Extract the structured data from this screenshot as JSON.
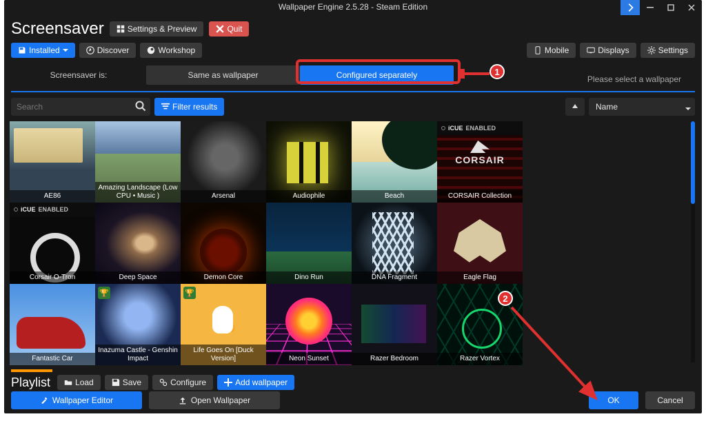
{
  "window": {
    "title": "Wallpaper Engine 2.5.28 - Steam Edition"
  },
  "header": {
    "page_title": "Screensaver",
    "settings_preview": "Settings & Preview",
    "quit": "Quit"
  },
  "nav": {
    "installed": "Installed",
    "discover": "Discover",
    "workshop": "Workshop",
    "mobile": "Mobile",
    "displays": "Displays",
    "settings": "Settings"
  },
  "mode": {
    "label": "Screensaver is:",
    "same": "Same as wallpaper",
    "separate": "Configured separately"
  },
  "filter": {
    "search_placeholder": "Search",
    "filter_results": "Filter results",
    "sort_field": "Name"
  },
  "right_pane": {
    "empty": "Please select a wallpaper"
  },
  "tiles": [
    {
      "label": "AE86",
      "bg": "bg-ae86",
      "trophy": false,
      "icue": false
    },
    {
      "label": "Amazing Landscape (Low CPU • Music )",
      "bg": "bg-landscape",
      "trophy": false,
      "icue": false
    },
    {
      "label": "Arsenal",
      "bg": "bg-arsenal",
      "trophy": false,
      "icue": false
    },
    {
      "label": "Audiophile",
      "bg": "bg-audio",
      "trophy": false,
      "icue": false
    },
    {
      "label": "Beach",
      "bg": "bg-beach",
      "trophy": false,
      "icue": false
    },
    {
      "label": "CORSAIR Collection",
      "bg": "bg-corsair",
      "trophy": false,
      "icue": true,
      "corsair_label": "CORSAIR"
    },
    {
      "label": "Corsair O-Tron",
      "bg": "bg-otron",
      "trophy": false,
      "icue": true
    },
    {
      "label": "Deep Space",
      "bg": "bg-deepspace",
      "trophy": false,
      "icue": false
    },
    {
      "label": "Demon Core",
      "bg": "bg-demon",
      "trophy": false,
      "icue": false
    },
    {
      "label": "Dino Run",
      "bg": "bg-dino",
      "trophy": false,
      "icue": false
    },
    {
      "label": "DNA Fragment",
      "bg": "bg-dna",
      "trophy": false,
      "icue": false
    },
    {
      "label": "Eagle Flag",
      "bg": "bg-eagle",
      "trophy": false,
      "icue": false
    },
    {
      "label": "Fantastic Car",
      "bg": "bg-car",
      "trophy": false,
      "icue": false
    },
    {
      "label": "Inazuma Castle - Genshin Impact",
      "bg": "bg-inazuma",
      "trophy": true,
      "icue": false
    },
    {
      "label": "Life Goes On [Duck Version]",
      "bg": "bg-duck",
      "trophy": true,
      "icue": false
    },
    {
      "label": "Neon Sunset",
      "bg": "bg-neon",
      "trophy": false,
      "icue": false
    },
    {
      "label": "Razer Bedroom",
      "bg": "bg-razerbed",
      "trophy": false,
      "icue": false
    },
    {
      "label": "Razer Vortex",
      "bg": "bg-razervortex",
      "trophy": false,
      "icue": false
    }
  ],
  "icue_text": {
    "brand": "iCUE",
    "enabled": "ENABLED"
  },
  "playlist": {
    "title": "Playlist",
    "load": "Load",
    "save": "Save",
    "configure": "Configure",
    "add": "Add wallpaper"
  },
  "footer": {
    "editor": "Wallpaper Editor",
    "open": "Open Wallpaper",
    "ok": "OK",
    "cancel": "Cancel"
  },
  "callouts": {
    "one": "1",
    "two": "2"
  }
}
